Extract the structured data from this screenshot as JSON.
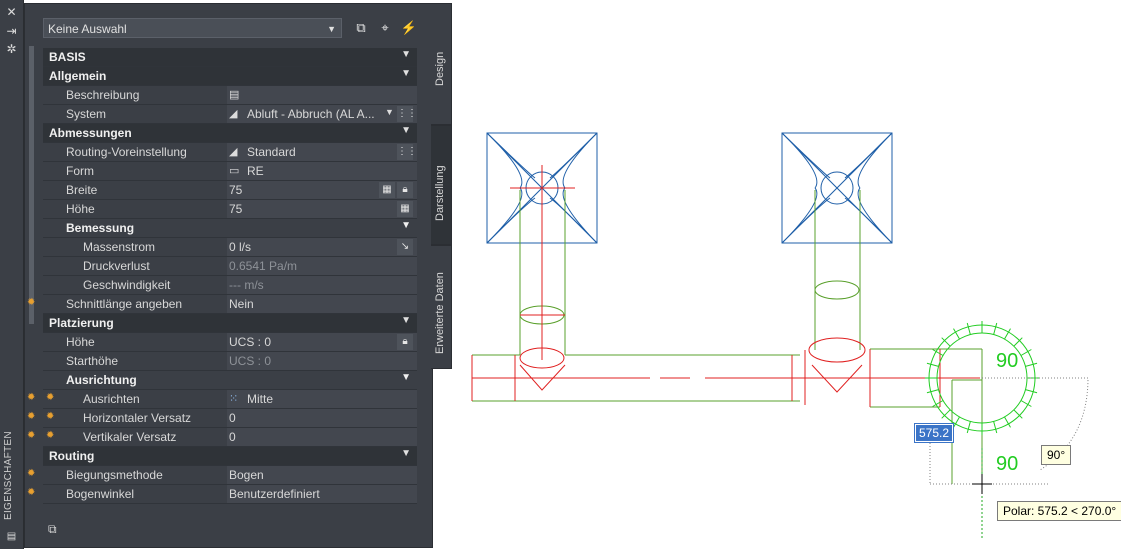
{
  "palette": {
    "title": "EIGENSCHAFTEN",
    "close_icon": "✕",
    "pin_icon": "⇥",
    "settings_icon": "✲"
  },
  "toolbar": {
    "selection": "Keine Auswahl"
  },
  "tabs": [
    "Design",
    "Darstellung",
    "Erweiterte Daten"
  ],
  "sections": {
    "basis": "BASIS",
    "allgemein": "Allgemein",
    "abmessungen": "Abmessungen",
    "bemessung": "Bemessung",
    "platzierung": "Platzierung",
    "ausrichtung": "Ausrichtung",
    "routing": "Routing"
  },
  "props": {
    "beschreibung": {
      "name": "Beschreibung",
      "value": ""
    },
    "system": {
      "name": "System",
      "value": "Abluft - Abbruch (AL A..."
    },
    "routing_voreinstellung": {
      "name": "Routing-Voreinstellung",
      "value": "Standard"
    },
    "form": {
      "name": "Form",
      "value": "RE"
    },
    "breite": {
      "name": "Breite",
      "value": "75"
    },
    "hoehe": {
      "name": "Höhe",
      "value": "75"
    },
    "massenstrom": {
      "name": "Massenstrom",
      "value": "0 l/s"
    },
    "druckverlust": {
      "name": "Druckverlust",
      "value": "0.6541 Pa/m"
    },
    "geschwindigkeit": {
      "name": "Geschwindigkeit",
      "value": "--- m/s"
    },
    "schnittlaenge": {
      "name": "Schnittlänge angeben",
      "value": "Nein"
    },
    "pl_hoehe": {
      "name": "Höhe",
      "value": "UCS : 0"
    },
    "starthoehe": {
      "name": "Starthöhe",
      "value": "UCS : 0"
    },
    "ausrichten": {
      "name": "Ausrichten",
      "value": "Mitte"
    },
    "hor_versatz": {
      "name": "Horizontaler Versatz",
      "value": "0"
    },
    "ver_versatz": {
      "name": "Vertikaler Versatz",
      "value": "0"
    },
    "biegungsmethode": {
      "name": "Biegungsmethode",
      "value": "Bogen"
    },
    "bogenwinkel": {
      "name": "Bogenwinkel",
      "value": "Benutzerdefiniert"
    }
  },
  "drawing": {
    "angle_label_1": "90",
    "angle_label_2": "90",
    "dynamic_input": "575.2",
    "angle_tooltip": "90°",
    "polar_tooltip": "Polar: 575.2 < 270.0°"
  },
  "colors": {
    "duct": "#5aa02c",
    "centerline": "#e02020",
    "diffuser": "#1f5fa8",
    "compass": "#22cc22",
    "panel_bg": "#3b3f46"
  }
}
